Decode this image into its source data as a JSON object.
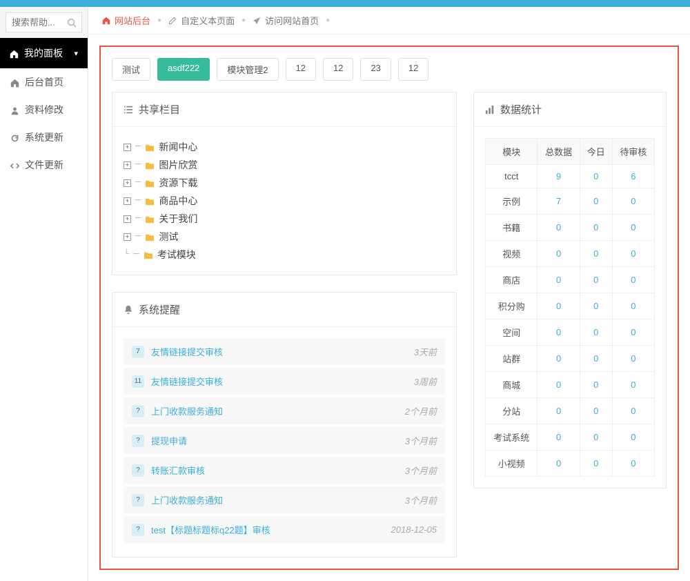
{
  "search": {
    "placeholder": "搜索帮助..."
  },
  "sidebar": {
    "panel_title": "我的面板",
    "items": [
      {
        "icon": "home",
        "label": "后台首页"
      },
      {
        "icon": "user",
        "label": "资料修改"
      },
      {
        "icon": "refresh",
        "label": "系统更新"
      },
      {
        "icon": "code",
        "label": "文件更新"
      }
    ]
  },
  "breadcrumb": {
    "home": "网站后台",
    "custom": "自定义本页面",
    "visit": "访问网站首页"
  },
  "tabs": [
    {
      "label": "测试",
      "active": false
    },
    {
      "label": "asdf222",
      "active": true
    },
    {
      "label": "模块管理2",
      "active": false
    },
    {
      "label": "12",
      "active": false
    },
    {
      "label": "12",
      "active": false
    },
    {
      "label": "23",
      "active": false
    },
    {
      "label": "12",
      "active": false
    }
  ],
  "share_panel": {
    "title": "共享栏目",
    "tree": [
      {
        "expandable": true,
        "label": "新闻中心"
      },
      {
        "expandable": true,
        "label": "图片欣赏"
      },
      {
        "expandable": true,
        "label": "资源下载"
      },
      {
        "expandable": true,
        "label": "商品中心"
      },
      {
        "expandable": true,
        "label": "关于我们"
      },
      {
        "expandable": true,
        "label": "测试"
      },
      {
        "expandable": false,
        "label": "考试模块"
      }
    ]
  },
  "notice_panel": {
    "title": "系统提醒",
    "items": [
      {
        "badge": "7",
        "text": "友情链接提交审核",
        "time": "3天前"
      },
      {
        "badge": "11",
        "text": "友情链接提交审核",
        "time": "3周前"
      },
      {
        "badge": "?",
        "text": "上门收款服务通知",
        "time": "2个月前"
      },
      {
        "badge": "?",
        "text": "提现申请",
        "time": "3个月前"
      },
      {
        "badge": "?",
        "text": "转账汇款审核",
        "time": "3个月前"
      },
      {
        "badge": "?",
        "text": "上门收款服务通知",
        "time": "3个月前"
      },
      {
        "badge": "?",
        "text": "test【标题标题标q22题】审核",
        "time": "2018-12-05"
      }
    ]
  },
  "stats_panel": {
    "title": "数据统计",
    "headers": [
      "模块",
      "总数据",
      "今日",
      "待审核"
    ],
    "rows": [
      {
        "mod": "tcct",
        "total": "9",
        "today": "0",
        "pending": "6"
      },
      {
        "mod": "示例",
        "total": "7",
        "today": "0",
        "pending": "0"
      },
      {
        "mod": "书籍",
        "total": "0",
        "today": "0",
        "pending": "0"
      },
      {
        "mod": "视频",
        "total": "0",
        "today": "0",
        "pending": "0"
      },
      {
        "mod": "商店",
        "total": "0",
        "today": "0",
        "pending": "0"
      },
      {
        "mod": "积分购",
        "total": "0",
        "today": "0",
        "pending": "0"
      },
      {
        "mod": "空间",
        "total": "0",
        "today": "0",
        "pending": "0"
      },
      {
        "mod": "站群",
        "total": "0",
        "today": "0",
        "pending": "0"
      },
      {
        "mod": "商城",
        "total": "0",
        "today": "0",
        "pending": "0"
      },
      {
        "mod": "分站",
        "total": "0",
        "today": "0",
        "pending": "0"
      },
      {
        "mod": "考试系统",
        "total": "0",
        "today": "0",
        "pending": "0"
      },
      {
        "mod": "小视频",
        "total": "0",
        "today": "0",
        "pending": "0"
      }
    ]
  }
}
